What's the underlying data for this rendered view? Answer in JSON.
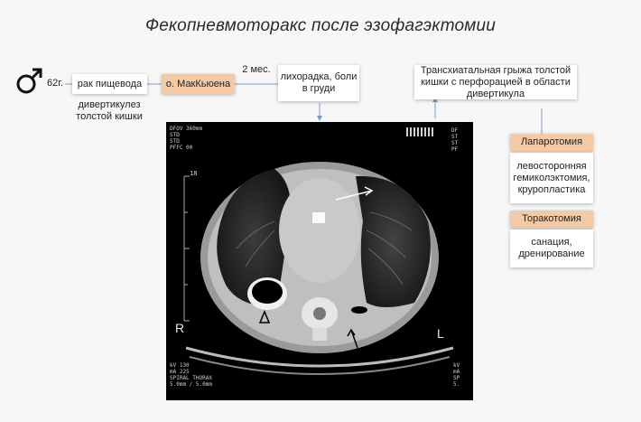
{
  "title": "Фекопневмоторакс после эзофагэктомии",
  "patient": {
    "age": "62г."
  },
  "boxes": {
    "cancer": "рак пищевода",
    "diverticulosis": "дивертикулез толстой кишки",
    "mckeown": "о. МакКьюена",
    "interval": "2 мес.",
    "symptoms": "лихорадка, боли в груди",
    "hernia": "Трансхиатальная грыжа толстой кишки с перфорацией в области дивертикула",
    "laparotomy": "Лапаротомия",
    "laparotomy_detail": "левосторонняя гемиколэктомия, круропластика",
    "thoracotomy": "Торакотомия",
    "thoracotomy_detail": "санация, дренирование"
  },
  "ct": {
    "right": "R",
    "left": "L",
    "scale_mark": "18",
    "top_left_text": [
      "DFOV 360mm",
      "STD",
      "STD",
      "PFFC 00"
    ],
    "bottom_left_text": [
      "kV 130",
      "mA 225",
      "SPIRAL THORAX",
      "5.0mm / 5.0mm"
    ],
    "right_text": [
      "DF",
      "ST",
      "ST",
      "PF"
    ],
    "right_bottom_text": [
      "kV",
      "mA",
      "SP",
      "5."
    ]
  },
  "colors": {
    "accent": "#f4c9a5",
    "connector": "#7a9bc4"
  }
}
